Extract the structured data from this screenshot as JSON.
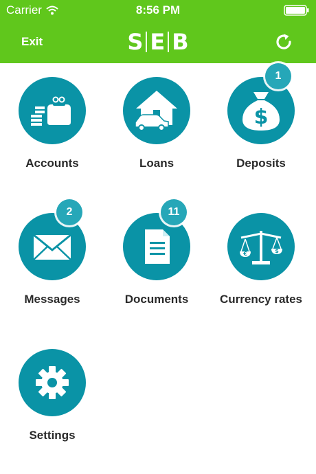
{
  "status_bar": {
    "carrier": "Carrier",
    "time": "8:56 PM"
  },
  "nav": {
    "exit_label": "Exit",
    "logo_letters": [
      "S",
      "E",
      "B"
    ]
  },
  "colors": {
    "brand_green": "#60c71c",
    "tile_teal": "#0a93a6",
    "badge_teal": "#26a7b8"
  },
  "tiles": [
    {
      "label": "Accounts",
      "icon": "wallet-coins-icon",
      "badge": ""
    },
    {
      "label": "Loans",
      "icon": "house-car-icon",
      "badge": ""
    },
    {
      "label": "Deposits",
      "icon": "money-bag-icon",
      "badge": "1"
    },
    {
      "label": "Messages",
      "icon": "envelope-icon",
      "badge": "2"
    },
    {
      "label": "Documents",
      "icon": "document-icon",
      "badge": "11"
    },
    {
      "label": "Currency rates",
      "icon": "balance-scale-icon",
      "badge": ""
    },
    {
      "label": "Settings",
      "icon": "gear-icon",
      "badge": ""
    }
  ]
}
